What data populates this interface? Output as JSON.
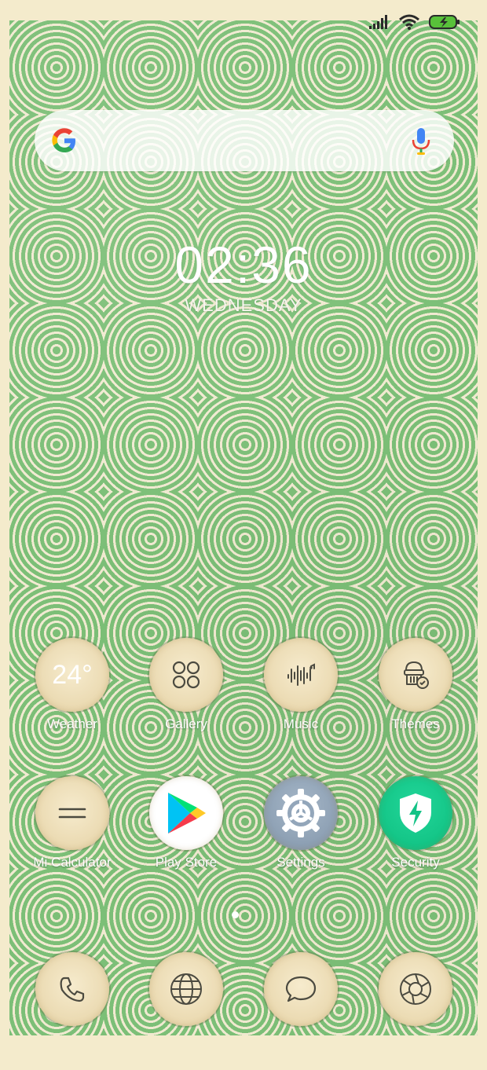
{
  "status_bar": {
    "signal_icon": "signal-bars-icon",
    "wifi_icon": "wifi-icon",
    "battery_icon": "battery-charging-icon"
  },
  "search": {
    "logo_icon": "google-g-icon",
    "mic_icon": "microphone-icon"
  },
  "clock": {
    "time": "02:36",
    "day": "WEDNESDAY"
  },
  "apps": [
    {
      "label": "Weather",
      "value": "24°",
      "icon": "weather-icon"
    },
    {
      "label": "Gallery",
      "icon": "gallery-grid-icon"
    },
    {
      "label": "Music",
      "icon": "music-waveform-icon"
    },
    {
      "label": "Themes",
      "icon": "themes-brush-icon"
    },
    {
      "label": "Mi Calculator",
      "icon": "calculator-equals-icon"
    },
    {
      "label": "Play Store",
      "icon": "play-store-icon"
    },
    {
      "label": "Settings",
      "icon": "settings-gear-icon"
    },
    {
      "label": "Security",
      "icon": "security-shield-icon"
    }
  ],
  "dock": [
    {
      "icon": "phone-icon"
    },
    {
      "icon": "browser-globe-icon"
    },
    {
      "icon": "messages-icon"
    },
    {
      "icon": "camera-icon"
    }
  ],
  "colors": {
    "wallpaper_green": "#7cbf77",
    "wallpaper_cream": "#f1ead1",
    "frame": "#f4ebcc",
    "battery": "#58c13a"
  }
}
